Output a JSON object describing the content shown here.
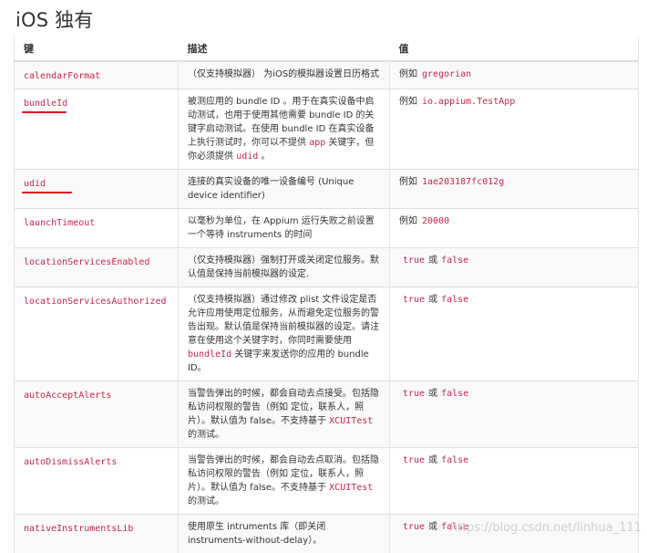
{
  "title": "iOS 独有",
  "headers": {
    "key": "键",
    "desc": "描述",
    "value": "值"
  },
  "rows": [
    {
      "key": "calendarFormat",
      "desc": [
        "（仅支持模拟器） 为iOS的模拟器设置日历格式"
      ],
      "value_prefix": "例如",
      "value_code": "gregorian"
    },
    {
      "key": "bundleId",
      "desc": [
        "被测应用的 bundle ID 。用于在真实设备中启动测试，也用于使用其他需要 bundle ID 的关键字启动测试。在使用 bundle ID 在真实设备上执行测试时，你可以不提供 ",
        "app",
        " 关键字，但你必须提供 ",
        "udid",
        " 。"
      ],
      "value_prefix": "例如",
      "value_code": "io.appium.TestApp"
    },
    {
      "key": "udid",
      "desc": [
        "连接的真实设备的唯一设备编号 (Unique device identifier)"
      ],
      "value_prefix": "例如",
      "value_code": "1ae203187fc012g"
    },
    {
      "key": "launchTimeout",
      "desc": [
        "以毫秒为单位，在 Appium 运行失败之前设置一个等待 instruments 的时间"
      ],
      "value_prefix": "例如",
      "value_code": "20000"
    },
    {
      "key": "locationServicesEnabled",
      "desc": [
        "（仅支持模拟器）强制打开或关闭定位服务。默认值是保持当前模拟器的设定."
      ],
      "value_true": "true",
      "value_or": "或",
      "value_false": "false"
    },
    {
      "key": "locationServicesAuthorized",
      "desc": [
        "（仅支持模拟器）通过修改 plist 文件设定是否允许应用使用定位服务，从而避免定位服务的警告出现。默认值是保持当前模拟器的设定。请注意在使用这个关键字时，你同时需要使用 ",
        "bundleId",
        " 关键字来发送你的应用的 bundle ID。"
      ],
      "value_true": "true",
      "value_or": "或",
      "value_false": "false"
    },
    {
      "key": "autoAcceptAlerts",
      "desc": [
        "当警告弹出的时候，都会自动去点接受。包括隐私访问权限的警告（例如 定位，联系人，照片）。默认值为 false。不支持基于 ",
        "XCUITest",
        " 的测试。"
      ],
      "value_true": "true",
      "value_or": "或",
      "value_false": "false"
    },
    {
      "key": "autoDismissAlerts",
      "desc": [
        "当警告弹出的时候，都会自动去点取消。包括隐私访问权限的警告（例如 定位，联系人，照片）。默认值为 false。不支持基于 ",
        "XCUITest",
        " 的测试。"
      ],
      "value_true": "true",
      "value_or": "或",
      "value_false": "false"
    },
    {
      "key": "nativeInstrumentsLib",
      "desc": [
        "使用原生 intruments 库（即关闭 instruments-without-delay）。"
      ],
      "value_true": "true",
      "value_or": "或",
      "value_false": "false"
    }
  ],
  "watermark": "https://blog.csdn.net/linhua_111",
  "colors": {
    "code": "#c7254e",
    "underline": "#e0101a",
    "border": "#dddddd"
  }
}
